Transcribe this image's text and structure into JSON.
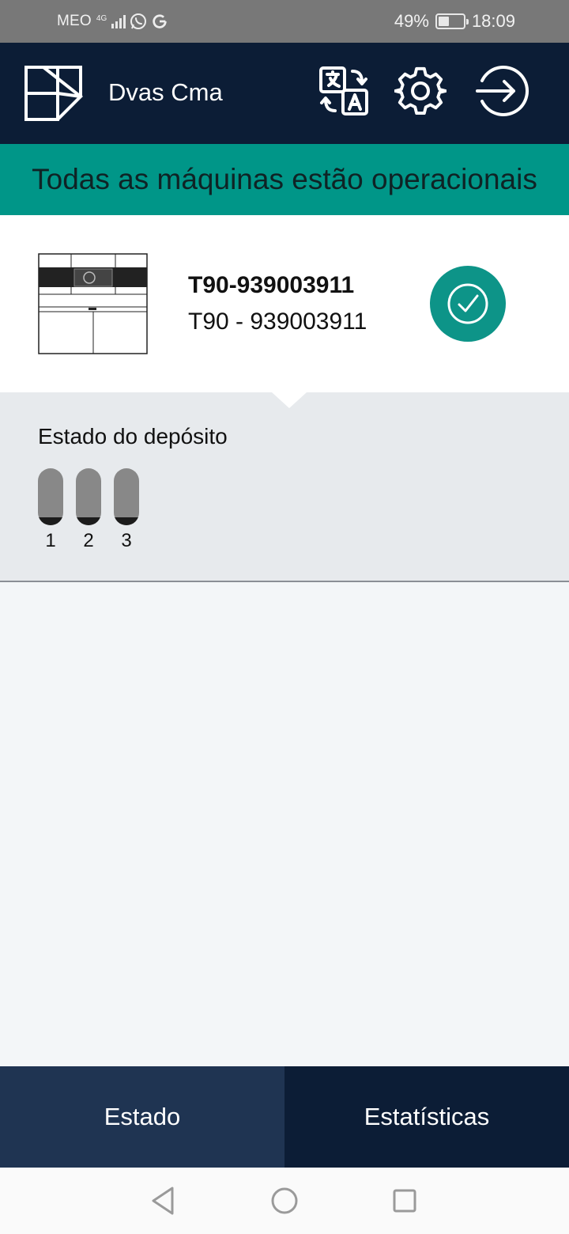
{
  "status_bar": {
    "carrier": "MEO",
    "network_top": "4G",
    "network_bottom": "4G",
    "battery_percent_text": "49%",
    "battery_level": 0.49,
    "time": "18:09",
    "icons": [
      "signal-icon",
      "whatsapp-icon",
      "google-icon",
      "battery-icon"
    ]
  },
  "header": {
    "user_name": "Dvas Cma",
    "icons": [
      "app-logo",
      "translate-icon",
      "settings-icon",
      "logout-icon"
    ]
  },
  "banner": {
    "message": "Todas as máquinas estão operacionais",
    "color": "#009688"
  },
  "machine": {
    "title": "T90-939003911",
    "subtitle": "T90 - 939003911",
    "status_icon": "check-circle-icon",
    "status_color": "#0d9488"
  },
  "tanks": {
    "title": "Estado do depósito",
    "items": [
      {
        "label": "1",
        "level": 0.14
      },
      {
        "label": "2",
        "level": 0.14
      },
      {
        "label": "3",
        "level": 0.14
      }
    ]
  },
  "bottom_nav": {
    "tabs": [
      {
        "label": "Estado",
        "active": true
      },
      {
        "label": "Estatísticas",
        "active": false
      }
    ]
  },
  "system_nav": {
    "icons": [
      "back-icon",
      "home-icon",
      "recent-apps-icon"
    ]
  },
  "colors": {
    "header_bg": "#0c1d36",
    "active_tab_bg": "#1f3452",
    "panel_bg": "#e7eaed",
    "page_bg": "#f3f6f8"
  }
}
